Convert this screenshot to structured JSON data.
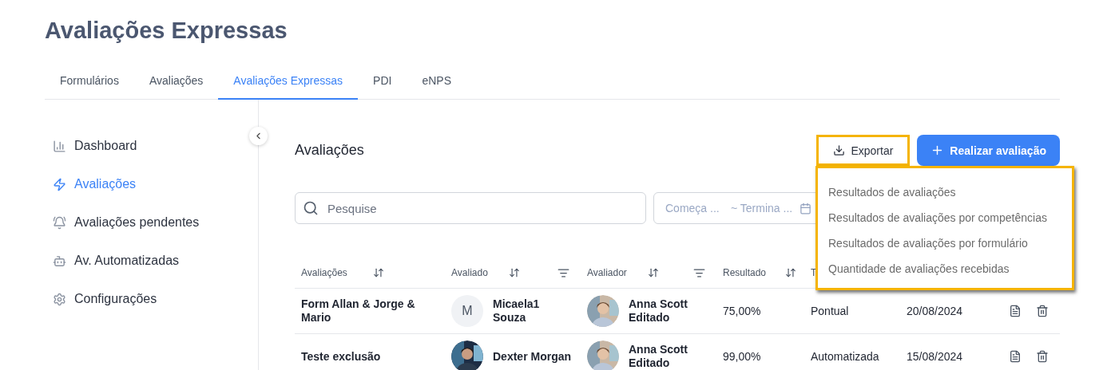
{
  "page_title": "Avaliações Expressas",
  "tabs": [
    {
      "label": "Formulários",
      "selected": false
    },
    {
      "label": "Avaliações",
      "selected": false
    },
    {
      "label": "Avaliações Expressas",
      "selected": true
    },
    {
      "label": "PDI",
      "selected": false
    },
    {
      "label": "eNPS",
      "selected": false
    }
  ],
  "sidebar": {
    "items": [
      {
        "label": "Dashboard",
        "selected": false
      },
      {
        "label": "Avaliações",
        "selected": true
      },
      {
        "label": "Avaliações pendentes",
        "selected": false
      },
      {
        "label": "Av. Automatizadas",
        "selected": false
      },
      {
        "label": "Configurações",
        "selected": false
      }
    ]
  },
  "section_title": "Avaliações",
  "export_button": {
    "label": "Exportar",
    "highlighted": true
  },
  "primary_button": {
    "label": "Realizar avaliação"
  },
  "search": {
    "placeholder": "Pesquise"
  },
  "date_range": {
    "start_placeholder": "Começa ...",
    "end_placeholder": "~ Termina ..."
  },
  "export_menu": {
    "highlighted": true,
    "items": [
      "Resultados de avaliações",
      "Resultados de avaliações por competências",
      "Resultados de avaliações por formulário",
      "Quantidade de avaliações recebidas"
    ]
  },
  "table": {
    "columns": [
      {
        "label": "Avaliações",
        "sortable": true,
        "filterable": false
      },
      {
        "label": "Avaliado",
        "sortable": true,
        "filterable": true
      },
      {
        "label": "Avaliador",
        "sortable": true,
        "filterable": true
      },
      {
        "label": "Resultado",
        "sortable": true,
        "filterable": false
      },
      {
        "label": "T"
      }
    ],
    "rows": [
      {
        "avaliacao": "Form Allan & Jorge & Mario",
        "avaliado": {
          "name": "Micaela1 Souza",
          "avatar": {
            "kind": "initial",
            "initial": "M"
          }
        },
        "avaliador": {
          "name": "Anna Scott Editado"
        },
        "resultado": "75,00%",
        "tipo": "Pontual",
        "data": "20/08/2024"
      },
      {
        "avaliacao": "Teste exclusão",
        "avaliado": {
          "name": "Dexter Morgan"
        },
        "avaliador": {
          "name": "Anna Scott Editado"
        },
        "resultado": "99,00%",
        "tipo": "Automatizada",
        "data": "15/08/2024"
      }
    ]
  }
}
